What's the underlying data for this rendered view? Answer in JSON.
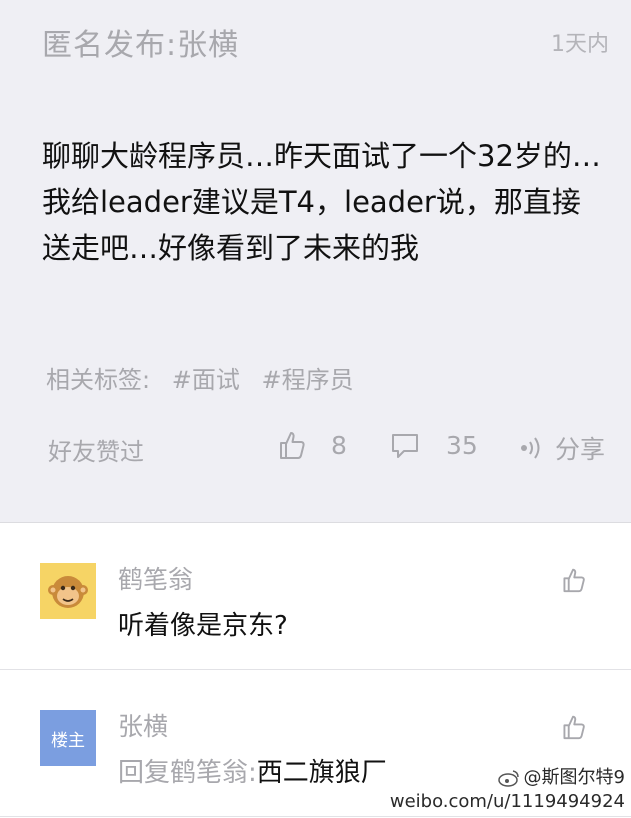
{
  "post": {
    "author": "匿名发布:张横",
    "time": "1天内",
    "body": "聊聊大龄程序员…昨天面试了一个32岁的…我给leader建议是T4，leader说，那直接送走吧…好像看到了未来的我",
    "tags_label": "相关标签:",
    "tags": [
      "#面试",
      "#程序员"
    ],
    "liked_by": "好友赞过",
    "like_count": "8",
    "comment_count": "35",
    "share_label": "分享"
  },
  "comments": [
    {
      "author": "鹤笔翁",
      "text": "听着像是京东?"
    },
    {
      "author": "张横",
      "badge": "楼主",
      "reply_prefix": "回复鹤笔翁:",
      "text": "西二旗狼厂"
    }
  ],
  "watermark": {
    "handle": "@斯图尔特9",
    "url": "weibo.com/u/1119494924"
  },
  "colors": {
    "post_bg": "#efeff4",
    "muted_text": "#a8a8ad",
    "body_text": "#111111",
    "host_badge": "#7b9ee0",
    "monkey_avatar": "#f6d465"
  }
}
